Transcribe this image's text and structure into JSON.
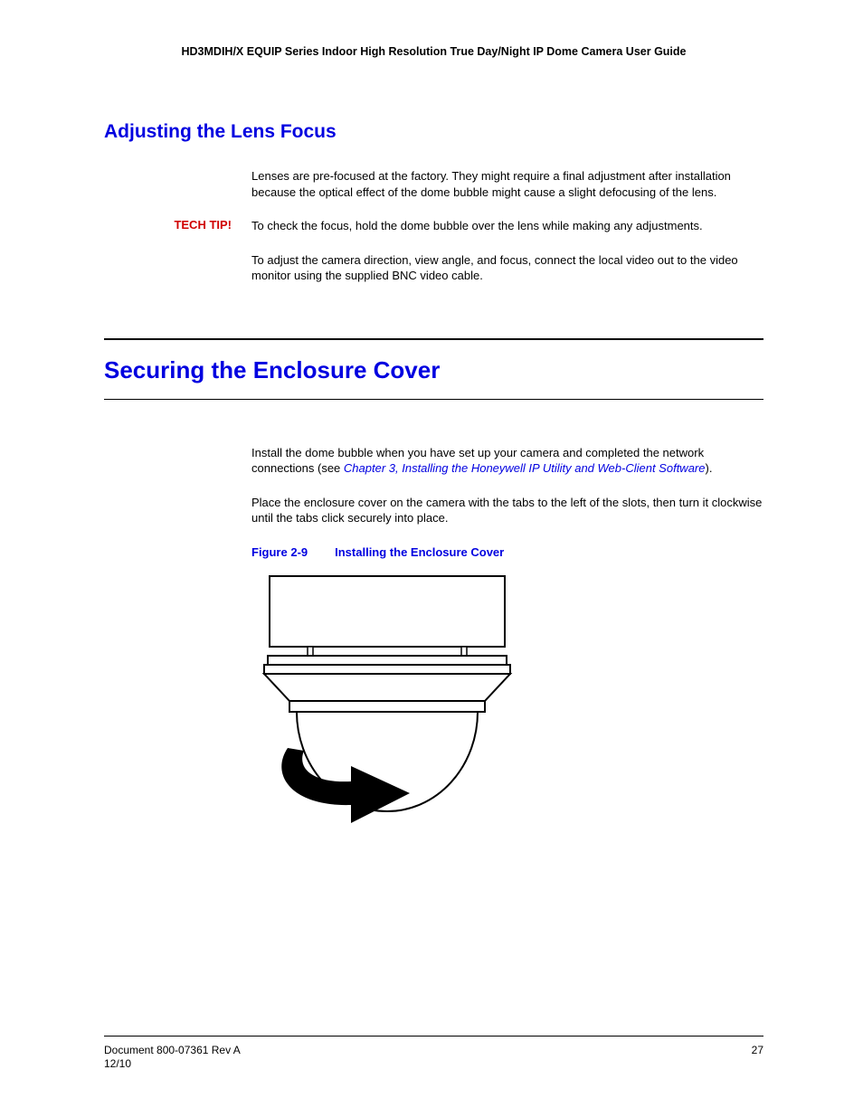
{
  "running_header": "HD3MDIH/X EQUIP Series Indoor High Resolution True Day/Night IP Dome Camera User Guide",
  "section1": {
    "title": "Adjusting the Lens Focus",
    "p1": "Lenses are pre-focused at the factory. They might require a final adjustment after installation because the optical effect of the dome bubble might cause a slight defocusing of the lens.",
    "tip_label": "TECH TIP!",
    "tip_body": "To check the focus, hold the dome bubble over the lens while making any adjustments.",
    "p2": "To adjust the camera direction, view angle, and focus, connect the local video out to the video monitor using the supplied BNC video cable."
  },
  "section2": {
    "title": "Securing the Enclosure Cover",
    "p1_a": "Install the dome bubble when you have set up your camera and completed the network connections (see ",
    "p1_link": "Chapter 3, Installing the Honeywell IP Utility and Web-Client Software",
    "p1_b": ").",
    "p2": "Place the enclosure cover on the camera with the tabs to the left of the slots, then turn it clockwise until the tabs click securely into place.",
    "fig_num": "Figure 2-9",
    "fig_title": "Installing the Enclosure Cover"
  },
  "footer": {
    "doc": "Document 800-07361 Rev A",
    "date": "12/10",
    "page": "27"
  }
}
